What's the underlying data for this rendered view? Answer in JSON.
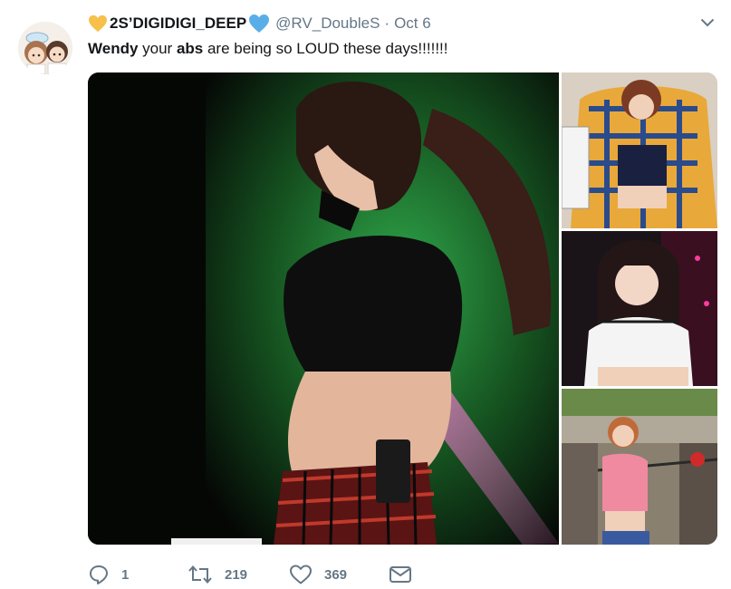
{
  "tweet": {
    "display_name": "2S’DIGIDIGI_DEEP",
    "handle": "@RV_DoubleS",
    "separator": "·",
    "time": "Oct 6",
    "text_parts": [
      "Wendy",
      " your ",
      "abs",
      " are being so LOUD these days!!!!!!!"
    ]
  },
  "actions": {
    "reply_count": "1",
    "retweet_count": "219",
    "like_count": "369"
  },
  "colors": {
    "text": "#14171a",
    "secondary": "#657786",
    "yellow_heart": "#f7c04a",
    "blue_heart": "#5aaee8"
  },
  "icons": [
    "yellow-heart-icon",
    "blue-heart-icon",
    "chevron-down-icon",
    "reply-icon",
    "retweet-icon",
    "like-icon",
    "message-icon"
  ]
}
